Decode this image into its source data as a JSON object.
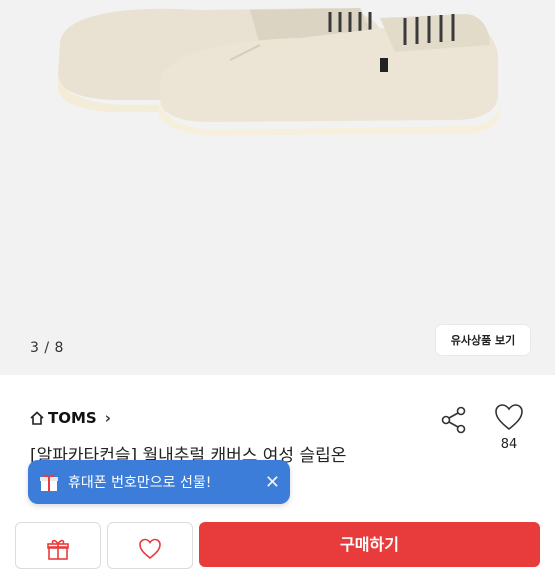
{
  "gallery": {
    "counter": "3 / 8",
    "similar_label": "유사상품 보기"
  },
  "product": {
    "brand": "TOMS",
    "title": "[알파카타컨슬] 월내추럴 캐버스 여성 슬립온",
    "like_count": "84"
  },
  "toast": {
    "message": "휴대폰 번호만으로 선물!"
  },
  "bottom_bar": {
    "buy_label": "구매하기"
  },
  "icons": {
    "home": "home-icon",
    "share": "share-icon",
    "heart": "heart-icon",
    "gift": "gift-icon",
    "close": "close-icon",
    "chevron": "chevron-right-icon"
  },
  "colors": {
    "accent_blue": "#3b7dd8",
    "buy_red": "#e83c3c"
  }
}
